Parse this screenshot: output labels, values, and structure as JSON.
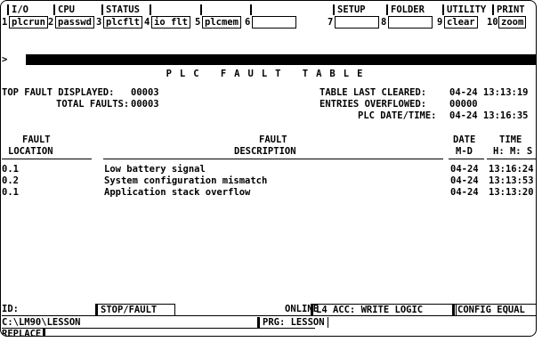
{
  "function_keys": [
    {
      "category": "I/O",
      "number": "1",
      "label": "plcrun"
    },
    {
      "category": "CPU",
      "number": "2",
      "label": "passwd"
    },
    {
      "category": "STATUS",
      "number": "3",
      "label": "plcflt"
    },
    {
      "category": "",
      "number": "4",
      "label": "io flt"
    },
    {
      "category": "",
      "number": "5",
      "label": "plcmem"
    },
    {
      "category": "",
      "number": "6",
      "label": ""
    },
    {
      "category": "SETUP",
      "number": "7",
      "label": ""
    },
    {
      "category": "FOLDER",
      "number": "8",
      "label": ""
    },
    {
      "category": "UTILITY",
      "number": "9",
      "label": "clear"
    },
    {
      "category": "PRINT",
      "number": "10",
      "label": "zoom"
    }
  ],
  "command_prompt": ">",
  "title": "PLC FAULT TABLE",
  "summary": {
    "top_fault_label": "TOP FAULT DISPLAYED:",
    "top_fault_value": "00003",
    "total_faults_label": "TOTAL FAULTS:",
    "total_faults_value": "00003",
    "table_cleared_label": "TABLE LAST CLEARED:",
    "table_cleared_value": "04-24 13:13:19",
    "entries_overflowed_label": "ENTRIES OVERFLOWED:",
    "entries_overflowed_value": "00000",
    "plc_datetime_label": "PLC DATE/TIME:",
    "plc_datetime_value": "04-24 13:16:35"
  },
  "columns": {
    "location_line1": "FAULT",
    "location_line2": "LOCATION",
    "description_line1": "FAULT",
    "description_line2": "DESCRIPTION",
    "date_line1": "DATE",
    "date_line2": "M-D",
    "time_line1": "TIME",
    "time_line2": "H: M: S"
  },
  "faults": [
    {
      "location": "0.1",
      "description": "Low battery signal",
      "date": "04-24",
      "time": "13:16:24"
    },
    {
      "location": "0.2",
      "description": "System configuration mismatch",
      "date": "04-24",
      "time": "13:13:53"
    },
    {
      "location": "0.1",
      "description": "Application stack overflow",
      "date": "04-24",
      "time": "13:13:20"
    }
  ],
  "status_bar": {
    "id_label": "ID:",
    "plc_state": "STOP/FAULT",
    "online": "ONLINE",
    "access": "L4 ACC: WRITE LOGIC",
    "config": "CONFIG EQUAL",
    "path": "C:\\LM90\\LESSON",
    "program": "PRG: LESSON",
    "mode": "REPLACE"
  }
}
